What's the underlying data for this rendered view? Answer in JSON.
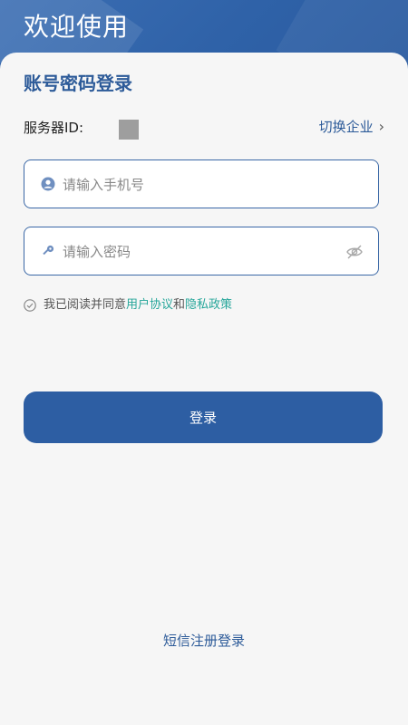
{
  "header": {
    "title": "欢迎使用"
  },
  "form": {
    "section_title": "账号密码登录",
    "server_label": "服务器ID:",
    "switch_company": "切换企业",
    "phone_placeholder": "请输入手机号",
    "password_placeholder": "请输入密码",
    "agree_prefix": "我已阅读并同意",
    "user_agreement": "用户协议",
    "agree_and": "和",
    "privacy_policy": "隐私政策",
    "login_button": "登录",
    "sms_login": "短信注册登录"
  },
  "colors": {
    "primary": "#2d5ea3",
    "link": "#26a69a",
    "background": "#f6f6f6"
  },
  "icons": [
    "user-icon",
    "key-icon",
    "eye-off-icon",
    "check-circle-icon",
    "chevron-right-icon"
  ]
}
